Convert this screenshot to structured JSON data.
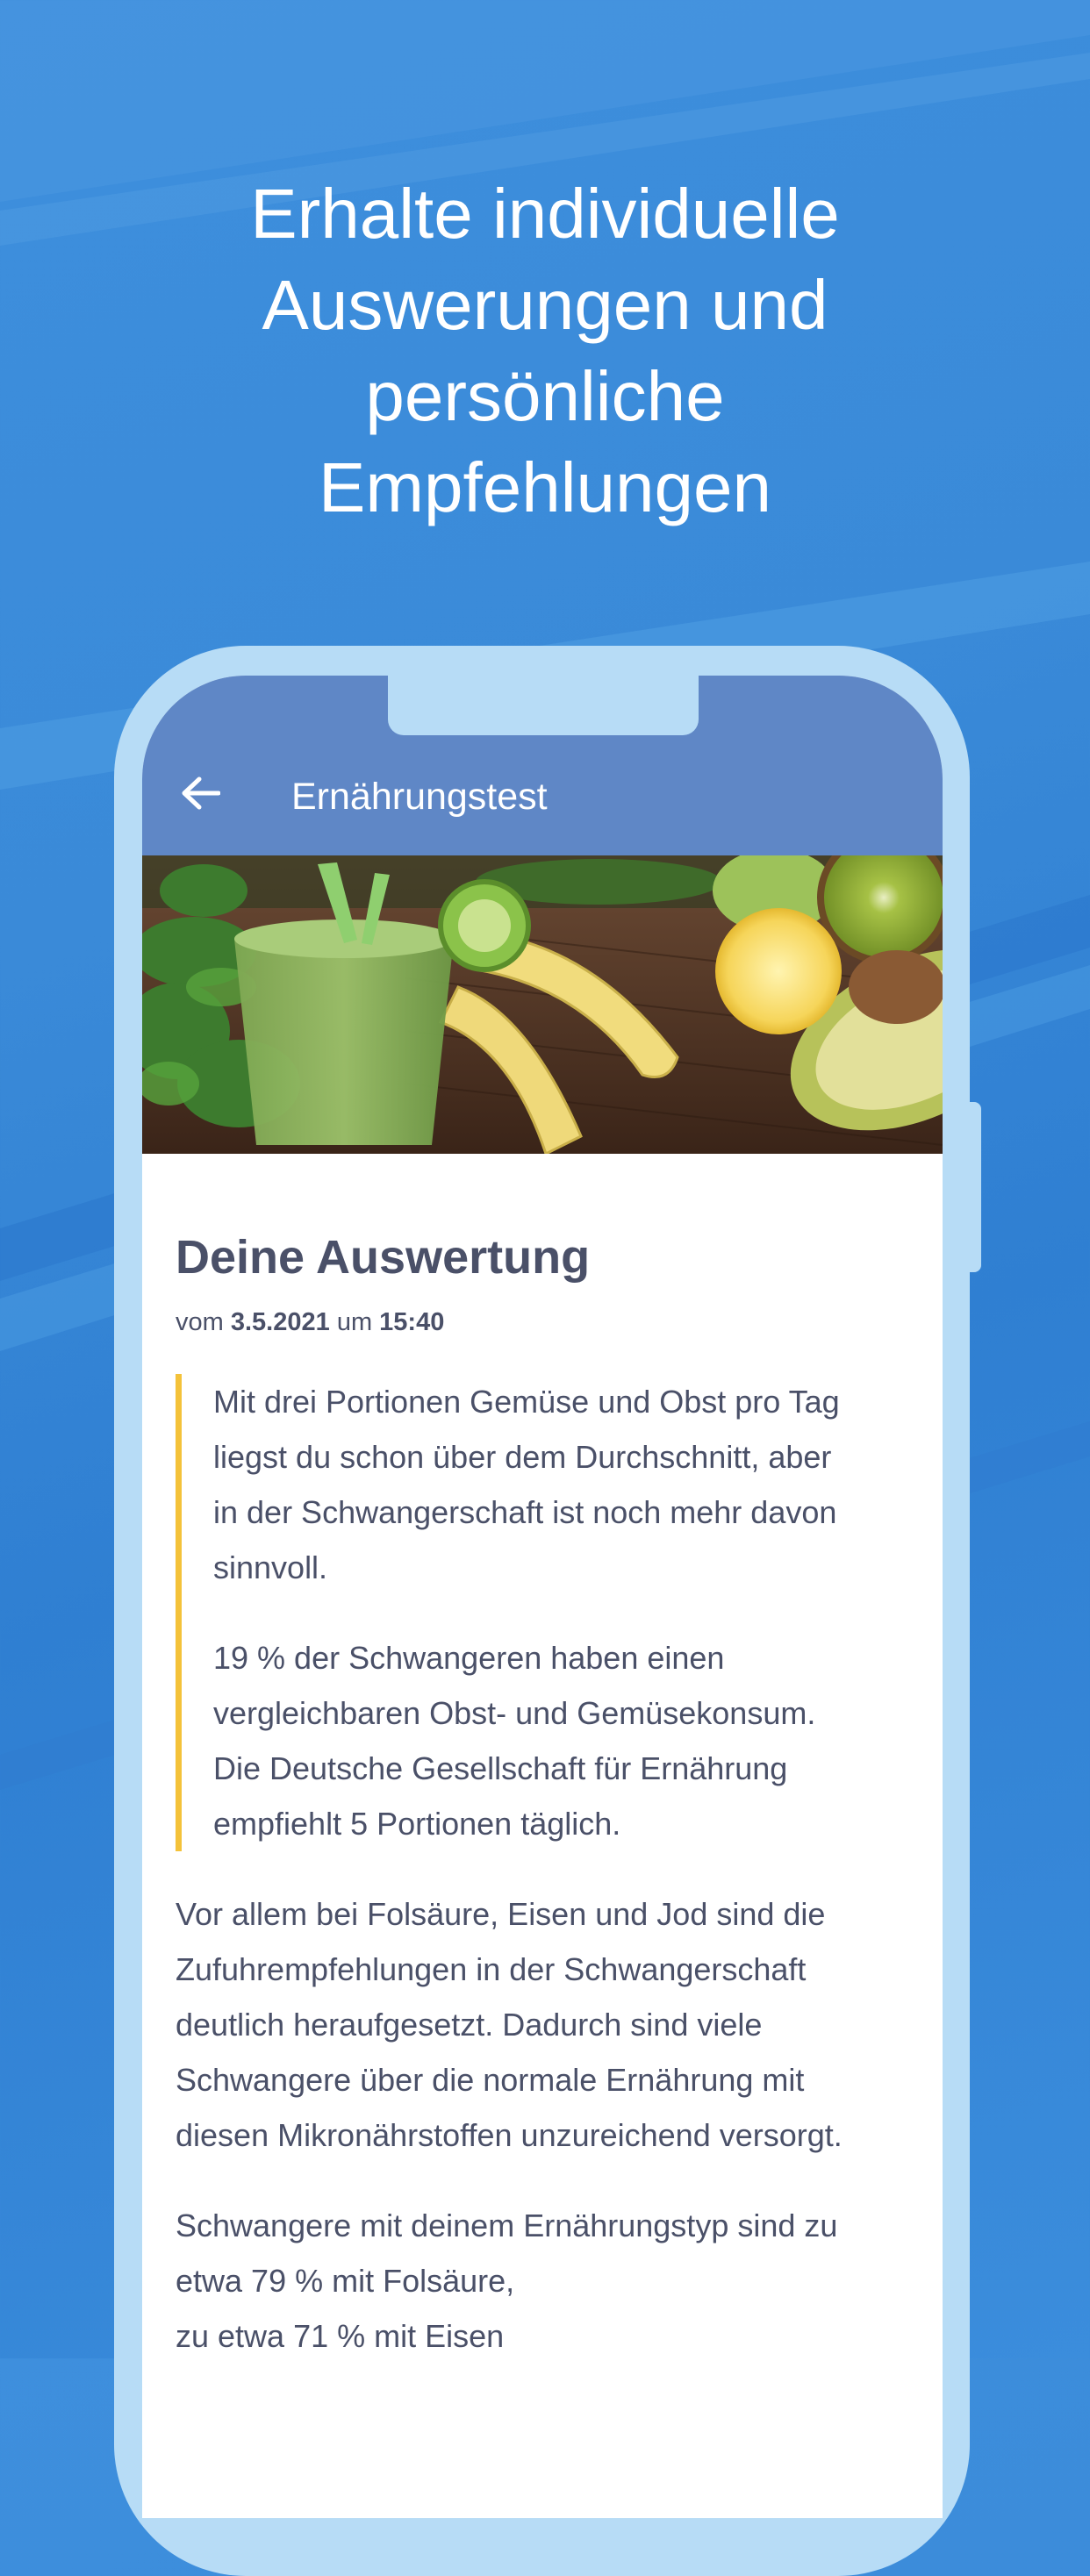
{
  "headline": {
    "lines": [
      "Erhalte individuelle",
      "Auswerungen und",
      "persönliche",
      "Empfehlungen"
    ]
  },
  "app_bar": {
    "back_icon": "arrow-left-icon",
    "title": "Ernährungstest"
  },
  "hero": {
    "image": "green-smoothie-fruit-photo"
  },
  "result": {
    "title": "Deine Auswertung",
    "date_prefix": "vom",
    "date": "3.5.2021",
    "time_prefix": "um",
    "time": "15:40"
  },
  "quote": {
    "p1": [
      "Mit drei Portionen Gemüse und Obst pro Tag",
      "liegst du schon über dem Durchschnitt, aber",
      "in der Schwangerschaft ist noch mehr davon",
      "sinnvoll."
    ],
    "p2": [
      "19 % der Schwangeren haben einen",
      "vergleichbaren Obst- und Gemüsekonsum.",
      "Die Deutsche Gesellschaft für Ernährung",
      "empfiehlt 5 Portionen täglich."
    ]
  },
  "body": {
    "p3": [
      "Vor allem bei Folsäure, Eisen und Jod sind die",
      "Zufuhrempfehlungen in der Schwangerschaft",
      "deutlich heraufgesetzt. Dadurch sind viele",
      "Schwangere über die normale Ernährung mit",
      "diesen Mikronährstoffen unzureichend versorgt."
    ],
    "p4": [
      "Schwangere mit deinem Ernährungstyp sind zu",
      "etwa 79 % mit Folsäure,",
      "zu etwa 71 % mit Eisen"
    ]
  },
  "colors": {
    "background": "#3a8ad8",
    "app_bar": "#5f87c6",
    "phone_frame": "#b7dcf6",
    "quote_accent": "#f4c23a",
    "text": "#4a5068"
  }
}
